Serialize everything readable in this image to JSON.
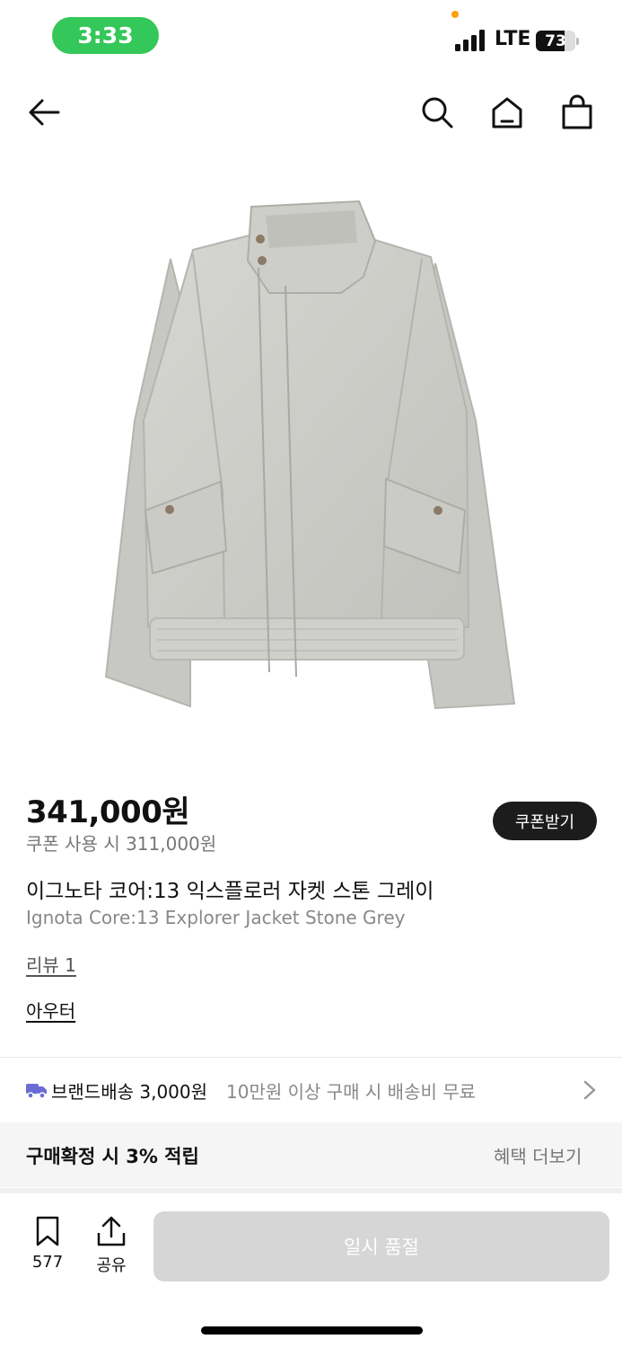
{
  "status_bar": {
    "time": "3:33",
    "network": "LTE",
    "battery": "73",
    "battery_level": 0.73
  },
  "header": {
    "icons": [
      "back-arrow-icon",
      "search-icon",
      "home-icon",
      "shopping-bag-icon"
    ]
  },
  "product": {
    "price": "341,000원",
    "coupon_price": "쿠폰 사용 시 311,000원",
    "coupon_button": "쿠폰받기",
    "title_ko": "이그노타 코어:13 익스플로러 자켓 스톤 그레이",
    "title_en": "Ignota Core:13 Explorer Jacket Stone Grey",
    "review_link": "리뷰 1",
    "category_link": "아우터"
  },
  "shipping": {
    "main": "브랜드배송 3,000원",
    "sub": "10만원 이상 구매 시 배송비 무료"
  },
  "points": {
    "text": "구매확정 시 3% 적립",
    "link": "혜택 더보기"
  },
  "bottom_bar": {
    "bookmark_count": "577",
    "share_label": "공유",
    "main_button": "일시 품절"
  },
  "colors": {
    "time_pill": "#34c759",
    "coupon_button_bg": "#1c1c1c",
    "soldout_button_bg": "#d6d6d6",
    "truck_icon": "#6b6bd6"
  }
}
